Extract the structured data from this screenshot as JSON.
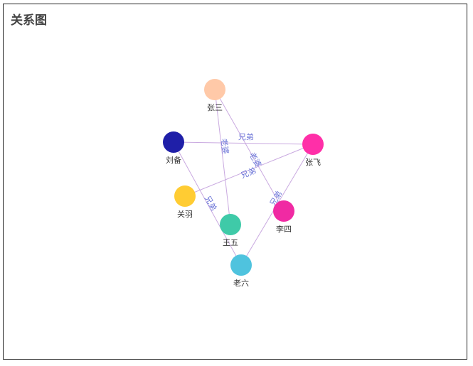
{
  "title": "关系图",
  "nodes": [
    {
      "id": "zhangsan",
      "name": "张三",
      "color": "#ffc9a8"
    },
    {
      "id": "liubei",
      "name": "刘备",
      "color": "#1f1fa8"
    },
    {
      "id": "zhangfei",
      "name": "张飞",
      "color": "#ff2fa8"
    },
    {
      "id": "guanyu",
      "name": "关羽",
      "color": "#ffcc33"
    },
    {
      "id": "lisi",
      "name": "李四",
      "color": "#f02aa3"
    },
    {
      "id": "wangwu",
      "name": "王五",
      "color": "#3fcaa8"
    },
    {
      "id": "laoliu",
      "name": "老六",
      "color": "#4fc3de"
    }
  ],
  "edges": [
    {
      "source": "liubei",
      "target": "zhangfei",
      "label": "兄弟"
    },
    {
      "source": "zhangsan",
      "target": "lisi",
      "label": "老婆"
    },
    {
      "source": "zhangsan",
      "target": "wangwu",
      "label": "老婆"
    },
    {
      "source": "zhangfei",
      "target": "guanyu",
      "label": "兄弟"
    },
    {
      "source": "liubei",
      "target": "laoliu",
      "label": "兄弟"
    },
    {
      "source": "zhangfei",
      "target": "laoliu",
      "label": "兄弟"
    }
  ]
}
